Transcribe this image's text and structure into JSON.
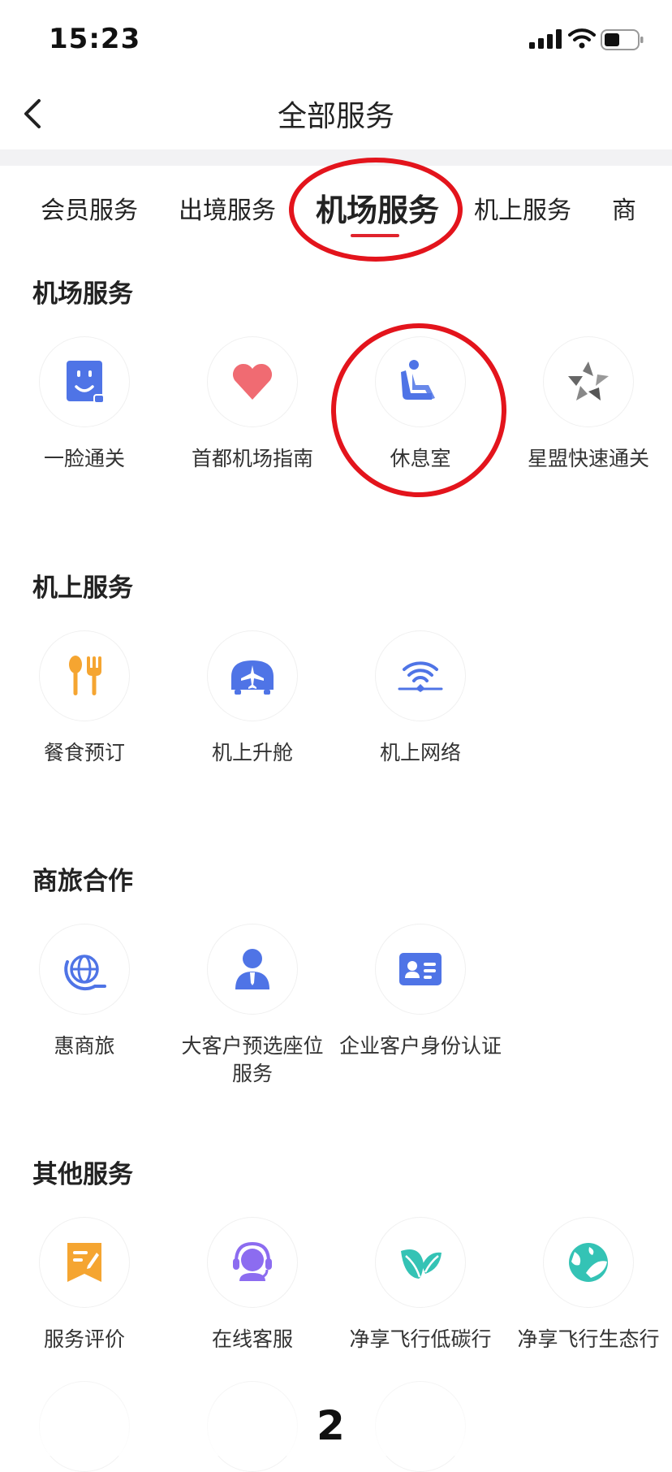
{
  "status": {
    "time": "15:23"
  },
  "nav": {
    "title": "全部服务"
  },
  "tabs": [
    "会员服务",
    "出境服务",
    "机场服务",
    "机上服务",
    "商"
  ],
  "sections": [
    {
      "title": "机场服务",
      "items": [
        {
          "label": "一脸通关",
          "icon": "face-icon"
        },
        {
          "label": "首都机场指南",
          "icon": "heart-icon"
        },
        {
          "label": "休息室",
          "icon": "seat-icon"
        },
        {
          "label": "星盟快速通关",
          "icon": "star-alliance-icon"
        }
      ]
    },
    {
      "title": "机上服务",
      "items": [
        {
          "label": "餐食预订",
          "icon": "dining-icon"
        },
        {
          "label": "机上升舱",
          "icon": "upgrade-plane-icon"
        },
        {
          "label": "机上网络",
          "icon": "wifi-plane-icon"
        }
      ]
    },
    {
      "title": "商旅合作",
      "items": [
        {
          "label": "惠商旅",
          "icon": "globe-icon"
        },
        {
          "label": "大客户预选座位服务",
          "icon": "person-icon"
        },
        {
          "label": "企业客户身份认证",
          "icon": "id-card-icon"
        }
      ]
    },
    {
      "title": "其他服务",
      "items": [
        {
          "label": "服务评价",
          "icon": "review-icon"
        },
        {
          "label": "在线客服",
          "icon": "headset-icon"
        },
        {
          "label": "净享飞行低碳行",
          "icon": "leaf-icon"
        },
        {
          "label": "净享飞行生态行",
          "icon": "eco-globe-icon"
        }
      ]
    }
  ],
  "page_number": "2",
  "colors": {
    "accent_red": "#e0232c",
    "icon_blue": "#4f74e6",
    "orange": "#f5a531",
    "teal": "#34c3b5",
    "purple": "#8c6cf0",
    "pink": "#f06b72"
  }
}
